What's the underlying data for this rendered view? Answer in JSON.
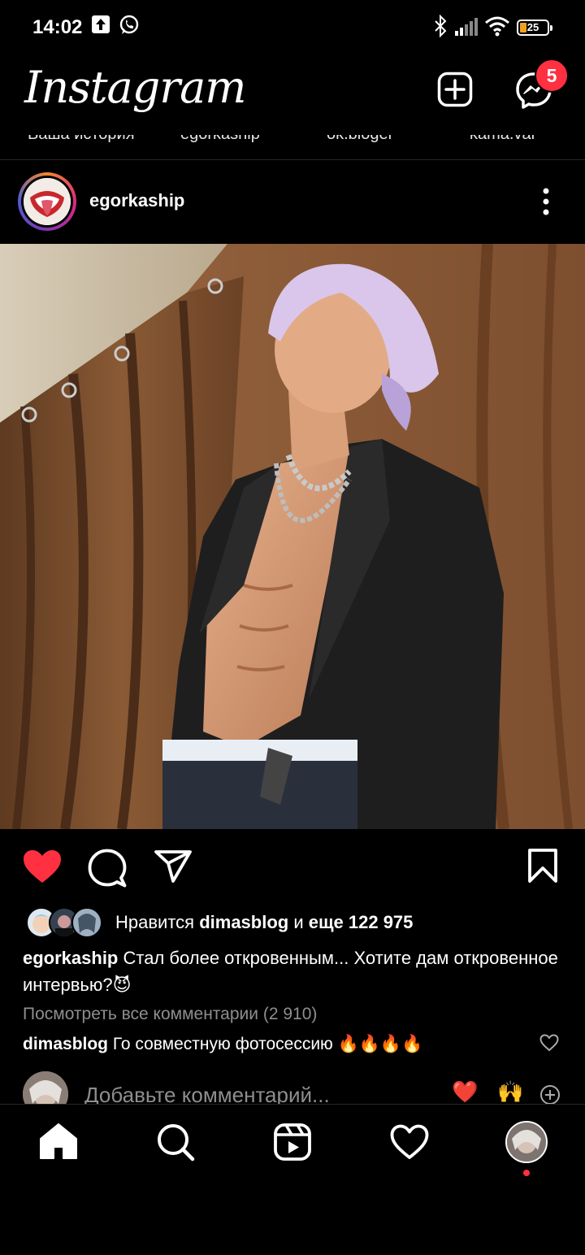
{
  "status_bar": {
    "time": "14:02",
    "battery": "25"
  },
  "header": {
    "logo": "Instagram",
    "messenger_badge": "5"
  },
  "stories": [
    "Ваша история",
    "egorkaship",
    "ok.bloger",
    "kama.var"
  ],
  "post": {
    "username": "egorkaship",
    "likes": {
      "prefix": "Нравится ",
      "liker": "dimasblog",
      "joiner": " и ",
      "rest": "еще 122 975"
    },
    "caption": {
      "user": "egorkaship",
      "text": " Стал более откровенным... Хотите дам откровенное интервью?😈"
    },
    "view_all_comments": "Посмотреть все комментарии (2 910)",
    "comment": {
      "user": "dimasblog",
      "text": " Го совместную фотосессию 🔥🔥🔥🔥"
    },
    "add_comment_placeholder": "Добавьте комментарий...",
    "quick_emojis": [
      "❤️",
      "🙌"
    ]
  },
  "colors": {
    "like": "#ff3040",
    "badge": "#ff3040",
    "secondary_text": "#8e8e8e"
  },
  "icons": {
    "header": [
      "add-post-icon",
      "messenger-icon"
    ],
    "actions": [
      "heart-filled-icon",
      "comment-icon",
      "share-icon",
      "bookmark-icon"
    ],
    "nav": [
      "home-icon",
      "search-icon",
      "reels-icon",
      "heart-icon",
      "profile-avatar"
    ]
  }
}
